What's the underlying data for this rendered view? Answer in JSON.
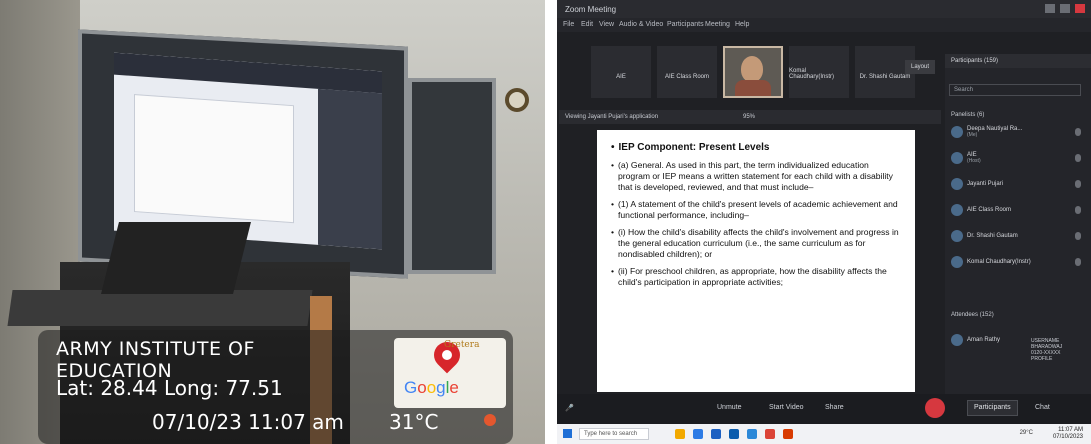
{
  "photo_overlay": {
    "location_line1": "ARMY INSTITUTE OF",
    "location_line2": "EDUCATION",
    "lat_long": "Lat: 28.44  Long: 77.51",
    "datetime": "07/10/23 11:07 am",
    "temperature": "31°C",
    "map_brand": "Google",
    "map_place_label": "Gretera"
  },
  "zoom": {
    "window_title": "Zoom Meeting",
    "menu": [
      "File",
      "Edit",
      "View",
      "Audio & Video",
      "Participants",
      "Meeting",
      "Help"
    ],
    "tiles": [
      "AIE",
      "AIE Class Room",
      "",
      "Komal Chaudhary(Instr)",
      "Dr. Shashi Gautam"
    ],
    "layout_label": "Layout",
    "share_status": "Viewing Jayanti Pujari's application",
    "zoom_level": "95%",
    "slide": {
      "title": "IEP Component: Present Levels",
      "paragraphs": [
        "(a) General. As used in this part, the term individualized education program or IEP means a written statement for each child with a disability that is developed, reviewed, and that must include–",
        "(1) A statement of the child's present levels of academic achievement and functional performance, including–",
        "(i) How the child's disability affects the child's involvement and progress in the general education curriculum (i.e., the same curriculum as for nondisabled children); or",
        "(ii) For preschool children, as appropriate, how the disability affects the child's participation in appropriate activities;"
      ]
    },
    "panel": {
      "title": "Participants (159)",
      "search_placeholder": "Search",
      "panelists_header": "Panelists (6)",
      "panelists": [
        {
          "name": "Deepa Nautiyal Ra...",
          "sub": "(Me)"
        },
        {
          "name": "AIE",
          "sub": "(Host)"
        },
        {
          "name": "Jayanti Pujari",
          "sub": ""
        },
        {
          "name": "AIE Class Room",
          "sub": ""
        },
        {
          "name": "Dr. Shashi Gautam",
          "sub": ""
        },
        {
          "name": "Komal Chaudhary(Instr)",
          "sub": ""
        }
      ],
      "attendees_header": "Attendees (152)",
      "attendee_first": "Aman Rathy",
      "attendee_meta": "USERNAME\nBHARADWAJ\n0120-XXXXX\nPROFILE"
    },
    "toolbar": {
      "unmute": "Unmute",
      "start_video": "Start Video",
      "share": "Share",
      "participants": "Participants",
      "chat": "Chat"
    },
    "taskbar": {
      "search_placeholder": "Type here to search",
      "temp": "29°C",
      "time": "11:07 AM",
      "date": "07/10/2023"
    }
  }
}
